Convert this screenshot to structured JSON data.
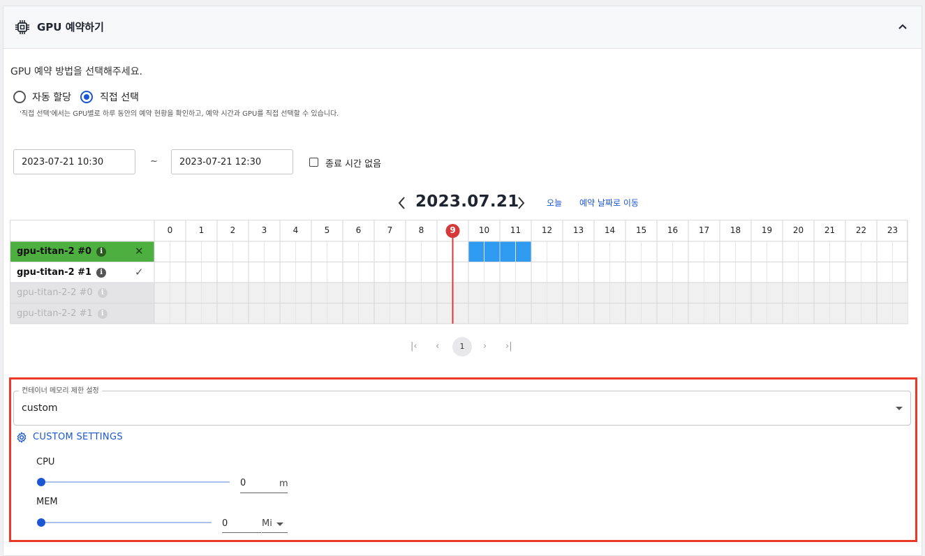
{
  "header": {
    "title": "GPU 예약하기",
    "icon": "chip-icon",
    "collapse_icon": "chevron-up-icon"
  },
  "method": {
    "instruction": "GPU 예약 방법을 선택해주세요.",
    "options": [
      {
        "label": "자동 할당",
        "selected": false
      },
      {
        "label": "직접 선택",
        "selected": true
      }
    ],
    "note": "'직접 선택'에서는 GPU별로 하루 동안의 예약 현황을 확인하고, 예약 시간과 GPU를 직접 선택할 수 있습니다."
  },
  "range": {
    "start": "2023-07-21 10:30",
    "separator": "~",
    "end": "2023-07-21 12:30",
    "no_end_label": "종료 시간 없음",
    "no_end_checked": false
  },
  "schedule": {
    "date": "2023.07.21",
    "today_label": "오늘",
    "goto_label": "예약 날짜로 이동",
    "current_hour": 9,
    "hours": [
      "0",
      "1",
      "2",
      "3",
      "4",
      "5",
      "6",
      "7",
      "8",
      "9",
      "10",
      "11",
      "12",
      "13",
      "14",
      "15",
      "16",
      "17",
      "18",
      "19",
      "20",
      "21",
      "22",
      "23"
    ],
    "gpus": [
      {
        "name": "gpu-titan-2 #0",
        "state": "selected",
        "action": "✕",
        "reserved_half_hours": [
          [
            20,
            24
          ]
        ]
      },
      {
        "name": "gpu-titan-2 #1",
        "state": "available",
        "action": "✓",
        "reserved_half_hours": []
      },
      {
        "name": "gpu-titan-2-2 #0",
        "state": "disabled",
        "action": "",
        "reserved_half_hours": []
      },
      {
        "name": "gpu-titan-2-2 #1",
        "state": "disabled",
        "action": "",
        "reserved_half_hours": []
      }
    ],
    "pager": {
      "first": "|‹",
      "prev": "‹",
      "page": "1",
      "next": "›",
      "last": "›|"
    }
  },
  "memory_limit": {
    "legend": "컨테이너 메모리 제한 설정",
    "value": "custom",
    "custom_label": "CUSTOM SETTINGS",
    "cpu": {
      "label": "CPU",
      "value": "0",
      "unit": "m",
      "slider_fraction": 0
    },
    "mem": {
      "label": "MEM",
      "value": "0",
      "unit": "Mi",
      "slider_fraction": 0
    }
  },
  "colors": {
    "selected_row": "#4caf3f",
    "reserved": "#2f9bf0",
    "now_line": "#d43a3a",
    "accent": "#1a56d6",
    "highlight_box": "#e8392b"
  }
}
